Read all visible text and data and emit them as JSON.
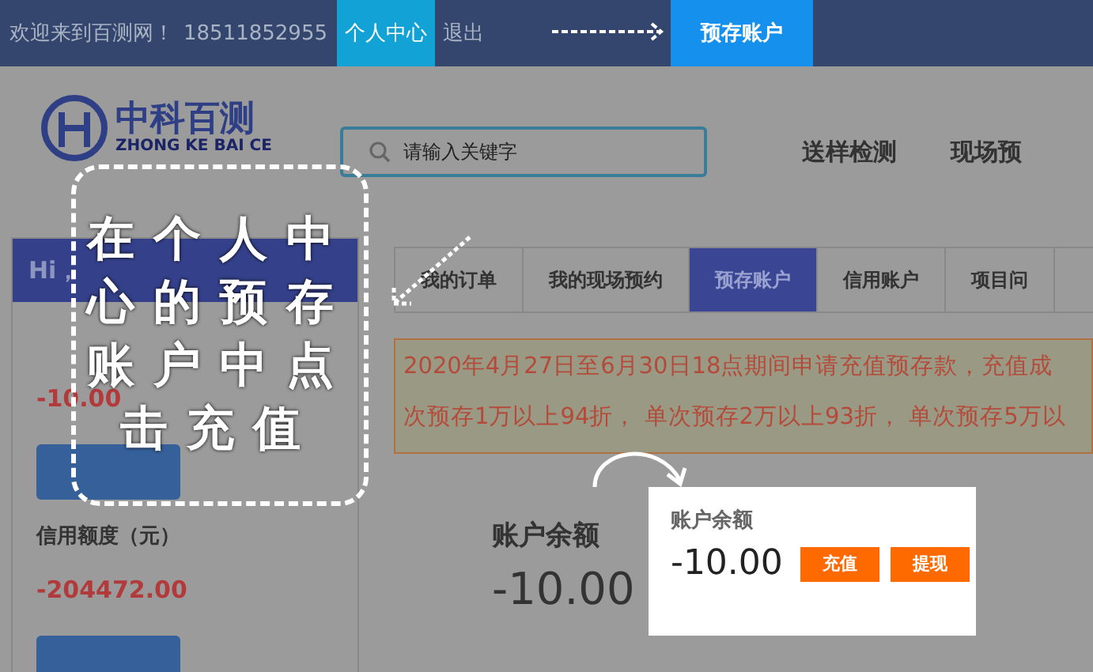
{
  "top_bar": {
    "welcome": "欢迎来到百测网！",
    "phone": "18511852955",
    "links": [
      {
        "label": "个人中心",
        "selected": true
      },
      {
        "label": "退出",
        "selected": false
      }
    ],
    "target_button": "预存账户"
  },
  "header": {
    "logo": {
      "name": "中科百测",
      "subtitle": "ZHONG KE BAI CE"
    },
    "search": {
      "placeholder": "请输入关键字"
    },
    "nav": [
      "送样检测",
      "现场预"
    ]
  },
  "sidebar": {
    "greeting": "Hi，",
    "balance_value": "-10.00",
    "credit_label": "信用额度（元）",
    "credit_value": "-204472.00"
  },
  "tabs": [
    {
      "label": "我的订单",
      "selected": false
    },
    {
      "label": "我的现场预约",
      "selected": false
    },
    {
      "label": "预存账户",
      "selected": true
    },
    {
      "label": "信用账户",
      "selected": false
    },
    {
      "label": "项目问",
      "selected": false
    }
  ],
  "notice": [
    "2020年4月27日至6月30日18点期间申请充值预存款，充值成",
    "次预存1万以上94折， 单次预存2万以上93折， 单次预存5万以"
  ],
  "balance": {
    "label": "账户余额",
    "value": "-10.00"
  },
  "callout": [
    "在个人中",
    "心的预存",
    "账户中点",
    "击充值"
  ],
  "highlight_card": {
    "label": "账户余额",
    "value": "-10.00",
    "buttons": [
      "充值",
      "提现"
    ]
  }
}
